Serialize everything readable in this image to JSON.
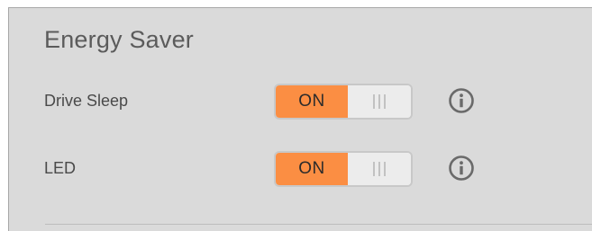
{
  "panel": {
    "title": "Energy Saver"
  },
  "settings": [
    {
      "label": "Drive Sleep",
      "toggle_on_label": "ON",
      "state": "on",
      "info_icon": "info-circle-icon"
    },
    {
      "label": "LED",
      "toggle_on_label": "ON",
      "state": "on",
      "info_icon": "info-circle-icon"
    }
  ],
  "colors": {
    "panel_bg": "#dadada",
    "toggle_on": "#fb8e43",
    "toggle_off": "#ececec",
    "text": "#4a4a4a",
    "icon": "#6a6a6a"
  }
}
